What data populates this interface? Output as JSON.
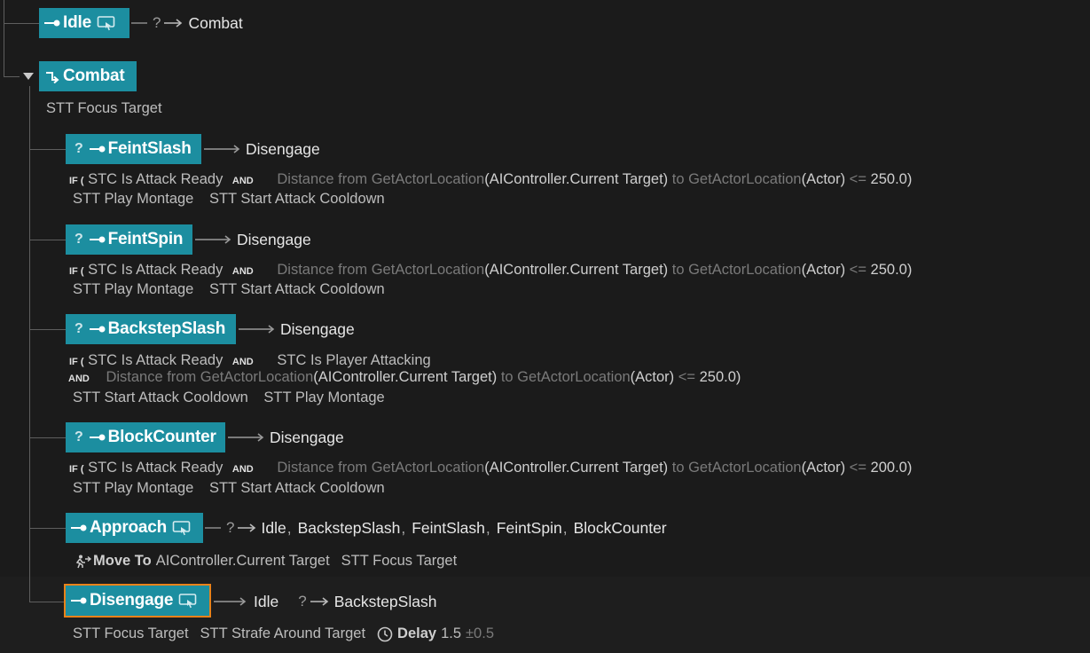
{
  "states": {
    "idle": {
      "name": "Idle",
      "transition": "Combat"
    },
    "combat": {
      "name": "Combat",
      "task": "STT Focus Target"
    },
    "feint_slash": {
      "name": "FeintSlash",
      "transition": "Disengage",
      "if": "IF (",
      "cond1": "STC Is Attack Ready",
      "and": "AND",
      "dist_prefix": "Distance from GetActorLocation",
      "dist_arg1": "(AIController.Current Target)",
      "dist_to": " to GetActorLocation",
      "dist_arg2": "(Actor)",
      "dist_op": " <=",
      "dist_value": " 250.0",
      "close": ")",
      "task1": "STT Play Montage",
      "task2": "STT Start Attack Cooldown"
    },
    "feint_spin": {
      "name": "FeintSpin",
      "transition": "Disengage",
      "if": "IF (",
      "cond1": "STC Is Attack Ready",
      "and": "AND",
      "dist_prefix": "Distance from GetActorLocation",
      "dist_arg1": "(AIController.Current Target)",
      "dist_to": " to GetActorLocation",
      "dist_arg2": "(Actor)",
      "dist_op": " <=",
      "dist_value": " 250.0",
      "close": ")",
      "task1": "STT Play Montage",
      "task2": "STT Start Attack Cooldown"
    },
    "backstep_slash": {
      "name": "BackstepSlash",
      "transition": "Disengage",
      "if": "IF (",
      "cond1": "STC Is Attack Ready",
      "and": "AND",
      "cond2": "STC Is Player Attacking",
      "dist_prefix": "Distance from GetActorLocation",
      "dist_arg1": "(AIController.Current Target)",
      "dist_to": " to GetActorLocation",
      "dist_arg2": "(Actor)",
      "dist_op": " <=",
      "dist_value": " 250.0",
      "close": ")",
      "task1": "STT Start Attack Cooldown",
      "task2": "STT Play Montage"
    },
    "block_counter": {
      "name": "BlockCounter",
      "transition": "Disengage",
      "if": "IF (",
      "cond1": "STC Is Attack Ready",
      "and": "AND",
      "dist_prefix": "Distance from GetActorLocation",
      "dist_arg1": "(AIController.Current Target)",
      "dist_to": " to GetActorLocation",
      "dist_arg2": "(Actor)",
      "dist_op": " <=",
      "dist_value": " 200.0",
      "close": ")",
      "task1": "STT Play Montage",
      "task2": "STT Start Attack Cooldown"
    },
    "approach": {
      "name": "Approach",
      "transitions": [
        "Idle",
        "BackstepSlash",
        "FeintSlash",
        "FeintSpin",
        "BlockCounter"
      ],
      "move_to_label": "Move To",
      "move_to_target": "AIController.Current Target",
      "task2": "STT Focus Target"
    },
    "disengage": {
      "name": "Disengage",
      "transition1": "Idle",
      "transition2": "BackstepSlash",
      "task1": "STT Focus Target",
      "task2": "STT Strafe Around Target",
      "delay_label": "Delay",
      "delay_value": "1.5",
      "delay_variance": "±0.5"
    }
  },
  "question_mark": "?",
  "comma": ",",
  "colors": {
    "state_node": "#1c8ea0",
    "selected_border": "#e8821a",
    "background": "#1b1b1b",
    "connector": "#5e5e5e"
  },
  "icons": {
    "enter": "enter-state-icon",
    "linked": "linked-state-icon",
    "sub_tree": "sub-tree-icon",
    "expand": "expand-arrow-icon",
    "arrow": "transition-arrow-icon",
    "move_to": "move-to-icon",
    "delay": "clock-icon"
  }
}
